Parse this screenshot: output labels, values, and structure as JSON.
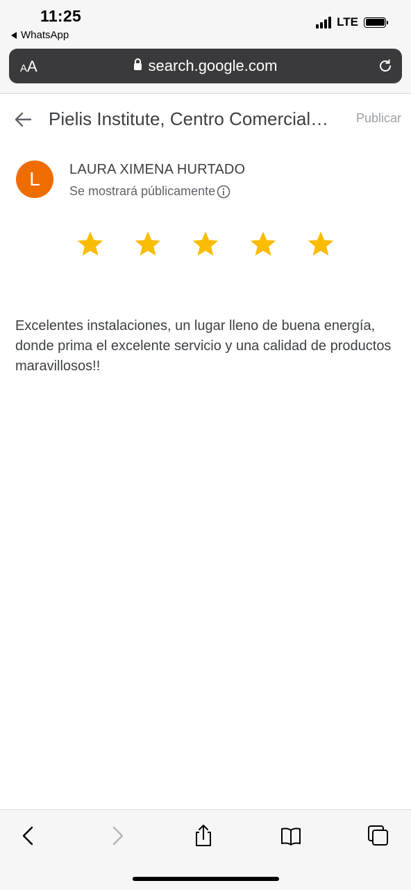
{
  "status_bar": {
    "time": "11:25",
    "back_app": "WhatsApp",
    "network": "LTE",
    "icons": [
      "signal-icon",
      "battery-icon"
    ]
  },
  "browser": {
    "text_size_label": "AA",
    "url": "search.google.com",
    "icons": [
      "lock-icon",
      "reload-icon"
    ]
  },
  "review_header": {
    "title": "Pielis Institute, Centro Comercial…",
    "publish_label": "Publicar"
  },
  "user": {
    "avatar_letter": "L",
    "avatar_color": "#ef6c00",
    "name": "LAURA XIMENA HURTADO",
    "visibility_note": "Se mostrará públicamente"
  },
  "rating": {
    "value": 5,
    "max": 5,
    "star_color": "#fbbc04"
  },
  "review": {
    "text": "Excelentes instalaciones, un lugar lleno de buena energía, donde prima el excelente servicio y una calidad de productos maravillosos!!"
  },
  "toolbar": {
    "icons": [
      "back-icon",
      "forward-icon",
      "share-icon",
      "bookmarks-icon",
      "tabs-icon"
    ]
  }
}
